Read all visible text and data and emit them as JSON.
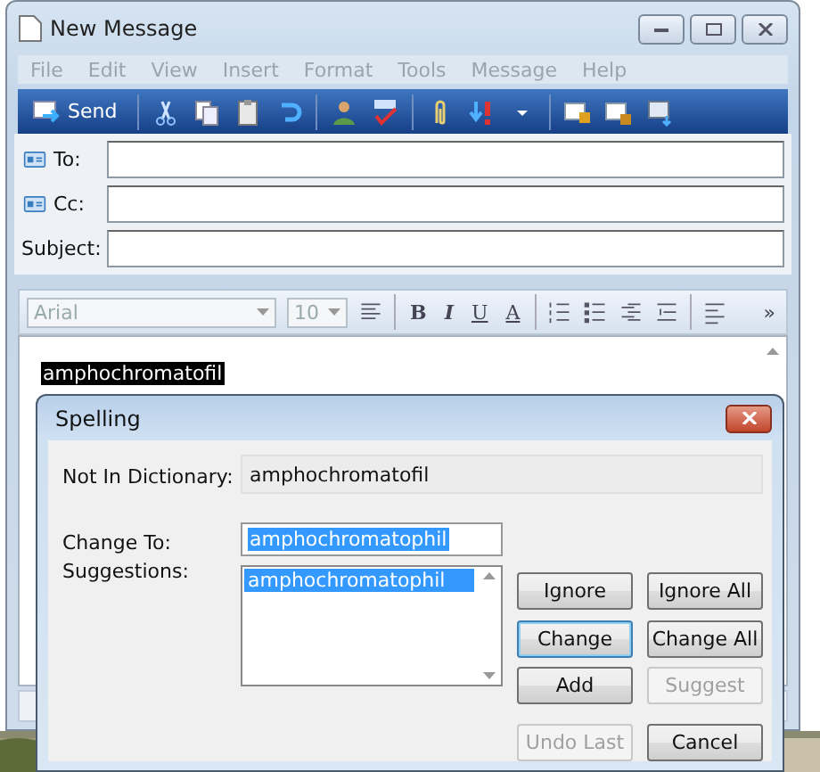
{
  "window": {
    "title": "New Message"
  },
  "menu": [
    "File",
    "Edit",
    "View",
    "Insert",
    "Format",
    "Tools",
    "Message",
    "Help"
  ],
  "toolbar": {
    "send": "Send"
  },
  "headers": [
    {
      "label": "To:",
      "kind": "address"
    },
    {
      "label": "Cc:",
      "kind": "address"
    },
    {
      "label": "Subject:",
      "kind": "plain"
    }
  ],
  "format_bar": {
    "font": "Arial",
    "size": "10",
    "bold": "B",
    "italic": "I",
    "underline": "U",
    "font_color": "A",
    "more": "»"
  },
  "body": {
    "text": "amphochromatofil",
    "selected": true
  },
  "dialog": {
    "title": "Spelling",
    "not_in_dictionary_label": "Not In Dictionary:",
    "not_in_dictionary": "amphochromatofil",
    "change_to_label": "Change To:",
    "change_to": "amphochromatophil",
    "suggestions_label": "Suggestions:",
    "suggestions": [
      {
        "text": "amphochromatophil",
        "selected": true
      }
    ],
    "buttons": [
      {
        "label": "Ignore",
        "disabled": false,
        "default": false
      },
      {
        "label": "Ignore All",
        "disabled": false,
        "default": false
      },
      {
        "label": "Change",
        "disabled": false,
        "default": true
      },
      {
        "label": "Change All",
        "disabled": false,
        "default": false
      },
      {
        "label": "Add",
        "disabled": false,
        "default": false
      },
      {
        "label": "Suggest",
        "disabled": true,
        "default": false
      },
      {
        "label": "Undo Last",
        "disabled": true,
        "default": false
      },
      {
        "label": "Cancel",
        "disabled": false,
        "default": false
      }
    ]
  }
}
